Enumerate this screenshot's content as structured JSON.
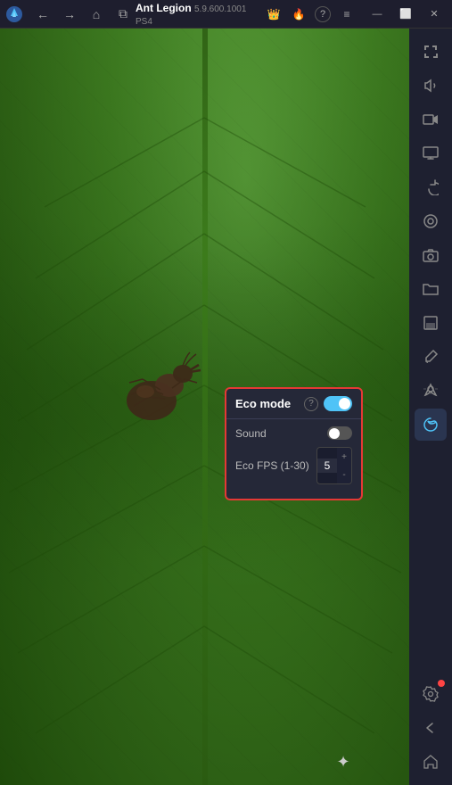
{
  "titlebar": {
    "app_name": "Ant Legion",
    "app_version": "5.9.600.1001  PS4",
    "nav": {
      "back_label": "←",
      "forward_label": "→",
      "home_label": "⌂",
      "multi_label": "⧉"
    },
    "icons": {
      "crown_label": "👑",
      "fire_label": "🔥",
      "help_label": "?",
      "menu_label": "≡"
    },
    "window_controls": {
      "minimize": "—",
      "maximize": "⬜",
      "close": "✕"
    }
  },
  "sidebar": {
    "buttons": [
      {
        "name": "fullscreen",
        "icon": "⛶",
        "active": false
      },
      {
        "name": "sound",
        "icon": "🔊",
        "active": false
      },
      {
        "name": "video",
        "icon": "▶",
        "active": false
      },
      {
        "name": "display",
        "icon": "🖥",
        "active": false
      },
      {
        "name": "rotate",
        "icon": "↺",
        "active": false
      },
      {
        "name": "settings2",
        "icon": "⊙",
        "active": false
      },
      {
        "name": "camera",
        "icon": "📷",
        "active": false
      },
      {
        "name": "folder",
        "icon": "📁",
        "active": false
      },
      {
        "name": "layers",
        "icon": "◱",
        "active": false
      },
      {
        "name": "brush",
        "icon": "✏",
        "active": false
      },
      {
        "name": "location",
        "icon": "◎",
        "active": false
      },
      {
        "name": "stack",
        "icon": "⬡",
        "active": true
      }
    ],
    "bottom_buttons": [
      {
        "name": "settings-gear",
        "icon": "⚙",
        "badge": true
      },
      {
        "name": "back-arrow",
        "icon": "←",
        "badge": false
      },
      {
        "name": "home-bottom",
        "icon": "⌂",
        "badge": false
      }
    ]
  },
  "eco_popup": {
    "title": "Eco mode",
    "help_icon": "?",
    "main_toggle_on": true,
    "sound_label": "Sound",
    "sound_toggle_on": false,
    "fps_label": "Eco FPS (1-30)",
    "fps_value": "5",
    "fps_decrement": "-",
    "fps_increment": "+"
  },
  "bottom": {
    "loader_icon": "✦"
  }
}
